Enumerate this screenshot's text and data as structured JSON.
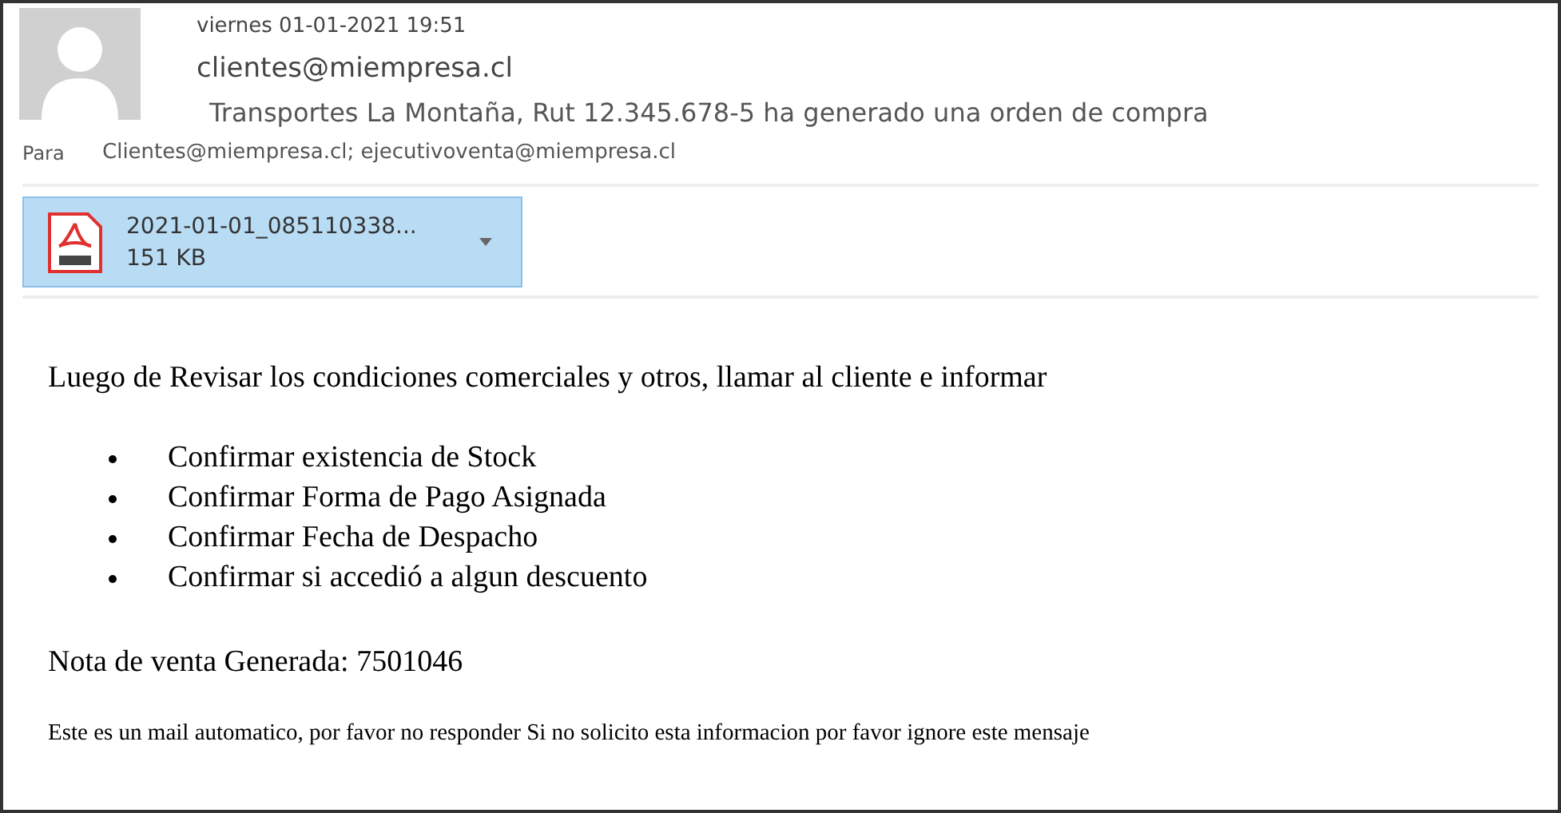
{
  "header": {
    "date": "viernes 01-01-2021 19:51",
    "sender": "clientes@miempresa.cl",
    "subject": "Transportes La Montaña, Rut 12.345.678-5 ha generado una orden de compra",
    "to_label": "Para",
    "recipients": "Clientes@miempresa.cl; ejecutivoventa@miempresa.cl"
  },
  "attachment": {
    "name": "2021-01-01_085110338...",
    "size": "151 KB",
    "selected": true
  },
  "body": {
    "intro": "Luego de Revisar los condiciones comerciales y otros, llamar al cliente e informar",
    "items": [
      "Confirmar existencia de Stock",
      "Confirmar Forma de Pago Asignada",
      "Confirmar Fecha de Despacho",
      "Confirmar si accedió a algun descuento"
    ],
    "note": "Nota de venta Generada: 7501046",
    "footer": "Este es un mail automatico, por favor no responder Si no solicito esta informacion por favor ignore este mensaje"
  }
}
